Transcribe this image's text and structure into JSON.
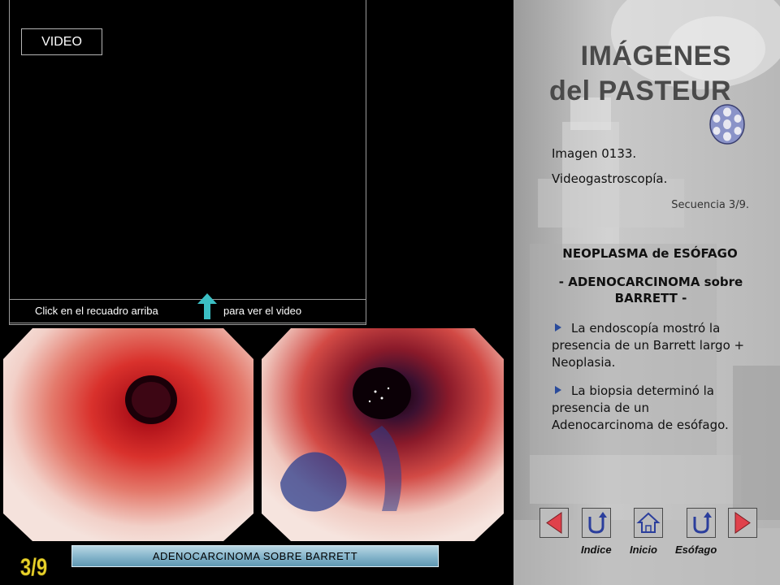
{
  "video": {
    "label": "VIDEO",
    "caption_left": "Click en el recuadro arriba",
    "caption_right": "para ver el video"
  },
  "footer": {
    "caption": "ADENOCARCINOMA  SOBRE  BARRETT",
    "sequence_badge": "3/9"
  },
  "title": {
    "line1": "IMÁGENES",
    "line2": "del PASTEUR"
  },
  "info": {
    "image_id": "Imagen   0133.",
    "image_type": "Videogastroscopía.",
    "sequence": "Secuencia  3/9.",
    "diagnosis_title": "NEOPLASMA de ESÓFAGO",
    "diagnosis_subtitle": "- ADENOCARCINOMA sobre BARRETT -",
    "bullets": [
      "La endoscopía mostró la presencia de un Barrett largo + Neoplasia.",
      "La biopsia determinó la presencia de un Adenocarcinoma de esófago."
    ]
  },
  "nav": {
    "indice": "Indice",
    "inicio": "Inicio",
    "esofago": "Esófago"
  },
  "colors": {
    "nav_arrow_red": "#e0414b",
    "nav_icon_blue": "#2b3e9c",
    "arrow_cyan": "#3bbfc4",
    "bullet_blue": "#2a4b9b",
    "badge_yellow": "#e8d22a"
  }
}
